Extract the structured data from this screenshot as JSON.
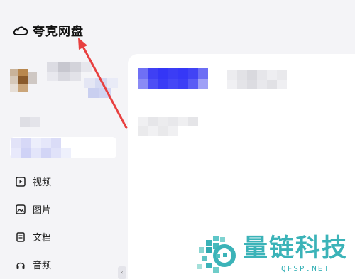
{
  "app": {
    "title": "夸克网盘",
    "logo_icon": "cloud-icon"
  },
  "sidebar": {
    "nav_items": [
      {
        "label": "视频",
        "icon": "video-icon"
      },
      {
        "label": "图片",
        "icon": "image-icon"
      },
      {
        "label": "文档",
        "icon": "document-icon"
      },
      {
        "label": "音频",
        "icon": "audio-icon"
      }
    ]
  },
  "watermark": {
    "title": "量链科技",
    "url": "QFSP.NET"
  },
  "colors": {
    "accent_blue": "#4a4cf7",
    "annotation_red": "#e84040",
    "watermark_teal": "#3bb3b8"
  }
}
